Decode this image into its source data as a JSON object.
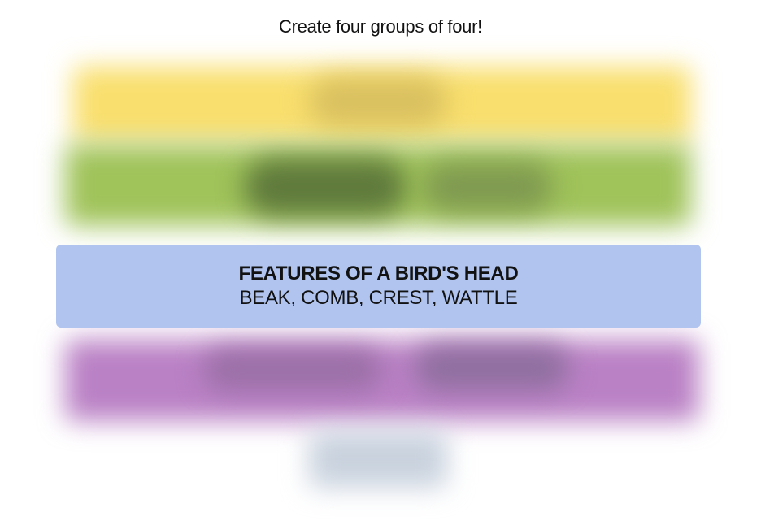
{
  "instructions": "Create four groups of four!",
  "colors": {
    "yellow": "#f9df6d",
    "green": "#a0c35a",
    "blue": "#b0c4ef",
    "purple": "#ba81c5",
    "dark_spot": "#4d6b2f",
    "grey": "#c9d2de"
  },
  "solved_groups": [
    {
      "color": "#b0c4ef",
      "title": "FEATURES OF A BIRD'S HEAD",
      "members": "BEAK, COMB, CREST, WATTLE"
    }
  ],
  "blurred_rows": [
    "yellow",
    "green",
    "purple"
  ]
}
